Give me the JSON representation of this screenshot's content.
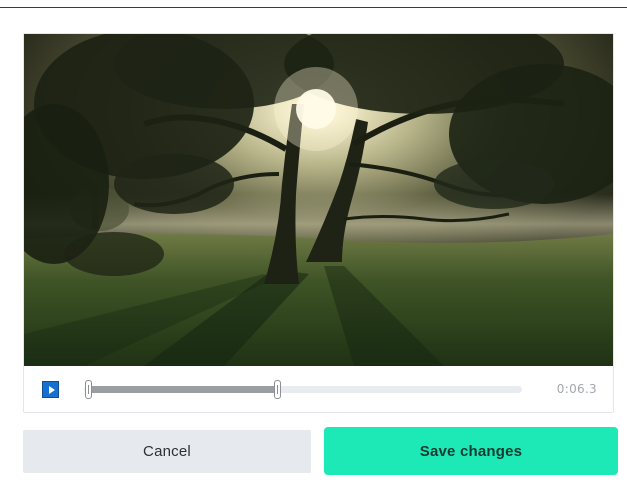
{
  "editor": {
    "video": {
      "description_icon": "video-frame"
    },
    "controls": {
      "play_icon": "play-icon",
      "trim_start_fraction": 0.0,
      "trim_end_fraction": 0.44,
      "timecode": "0:06.3"
    }
  },
  "actions": {
    "cancel_label": "Cancel",
    "save_label": "Save changes"
  },
  "colors": {
    "play_button": "#1570cf",
    "save_button": "#1de9b6",
    "cancel_button": "#e6e9ed",
    "timeline_track": "#e8ebef",
    "timeline_selection": "#9a9da2"
  }
}
